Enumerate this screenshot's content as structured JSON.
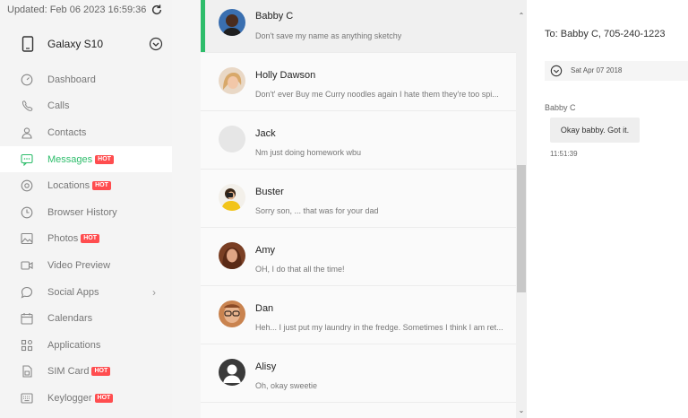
{
  "sidebar": {
    "updated": "Updated: Feb 06 2023 16:59:36",
    "device_name": "Galaxy S10",
    "hot_label": "HOT",
    "items": [
      {
        "label": "Dashboard",
        "icon": "dashboard-icon",
        "hot": false,
        "active": false
      },
      {
        "label": "Calls",
        "icon": "phone-icon",
        "hot": false,
        "active": false
      },
      {
        "label": "Contacts",
        "icon": "contact-icon",
        "hot": false,
        "active": false
      },
      {
        "label": "Messages",
        "icon": "message-icon",
        "hot": true,
        "active": true
      },
      {
        "label": "Locations",
        "icon": "location-icon",
        "hot": true,
        "active": false
      },
      {
        "label": "Browser History",
        "icon": "clock-icon",
        "hot": false,
        "active": false
      },
      {
        "label": "Photos",
        "icon": "photo-icon",
        "hot": true,
        "active": false
      },
      {
        "label": "Video Preview",
        "icon": "video-icon",
        "hot": false,
        "active": false
      },
      {
        "label": "Social Apps",
        "icon": "chat-bubble-icon",
        "hot": false,
        "active": false,
        "arrow": "›"
      },
      {
        "label": "Calendars",
        "icon": "calendar-icon",
        "hot": false,
        "active": false
      },
      {
        "label": "Applications",
        "icon": "apps-icon",
        "hot": false,
        "active": false
      },
      {
        "label": "SIM Card",
        "icon": "sim-card-icon",
        "hot": true,
        "active": false
      },
      {
        "label": "Keylogger",
        "icon": "keyboard-icon",
        "hot": true,
        "active": false
      }
    ]
  },
  "conversations": [
    {
      "name": "Babby C",
      "preview": "Don't save my name as anything sketchy",
      "selected": true,
      "avatar": "photo-dark"
    },
    {
      "name": "Holly Dawson",
      "preview": "Don't' ever Buy me Curry noodles again I hate them they're too spi...",
      "selected": false,
      "avatar": "photo-blonde"
    },
    {
      "name": "Jack",
      "preview": "Nm just doing homework wbu",
      "selected": false,
      "avatar": "placeholder"
    },
    {
      "name": "Buster",
      "preview": "Sorry son, ... that was for your dad",
      "selected": false,
      "avatar": "photo-yellow"
    },
    {
      "name": "Amy",
      "preview": "OH, I do that all the time!",
      "selected": false,
      "avatar": "photo-brown"
    },
    {
      "name": "Dan",
      "preview": "Heh... I just put my laundry in the fredge. Sometimes I think I am ret...",
      "selected": false,
      "avatar": "photo-glasses"
    },
    {
      "name": "Alisy",
      "preview": "Oh, okay sweetie",
      "selected": false,
      "avatar": "default-user"
    }
  ],
  "chat": {
    "to": "To: Babby C, 705-240-1223",
    "date": "Sat Apr 07 2018",
    "sender": "Babby C",
    "message": "Okay babby. Got it.",
    "time": "11:51:39"
  },
  "colors": {
    "accent": "#2ebd6b",
    "hot": "#ff4d4f"
  }
}
